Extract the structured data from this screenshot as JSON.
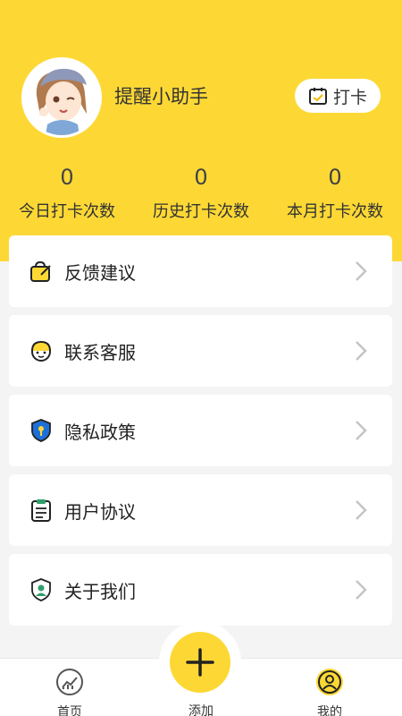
{
  "profile": {
    "username": "提醒小助手",
    "checkin_label": "打卡"
  },
  "stats": [
    {
      "value": "0",
      "label": "今日打卡次数"
    },
    {
      "value": "0",
      "label": "历史打卡次数"
    },
    {
      "value": "0",
      "label": "本月打卡次数"
    }
  ],
  "menu": [
    {
      "label": "反馈建议",
      "icon": "feedback-icon"
    },
    {
      "label": "联系客服",
      "icon": "customer-service-icon"
    },
    {
      "label": "隐私政策",
      "icon": "privacy-shield-icon"
    },
    {
      "label": "用户协议",
      "icon": "agreement-icon"
    },
    {
      "label": "关于我们",
      "icon": "about-us-icon"
    }
  ],
  "tabs": {
    "home": "首页",
    "add": "添加",
    "mine": "我的"
  },
  "colors": {
    "accent": "#fdd835",
    "icon_green": "#2e9e6a",
    "icon_blue": "#1e6fd9",
    "icon_yellow": "#f5b800"
  }
}
